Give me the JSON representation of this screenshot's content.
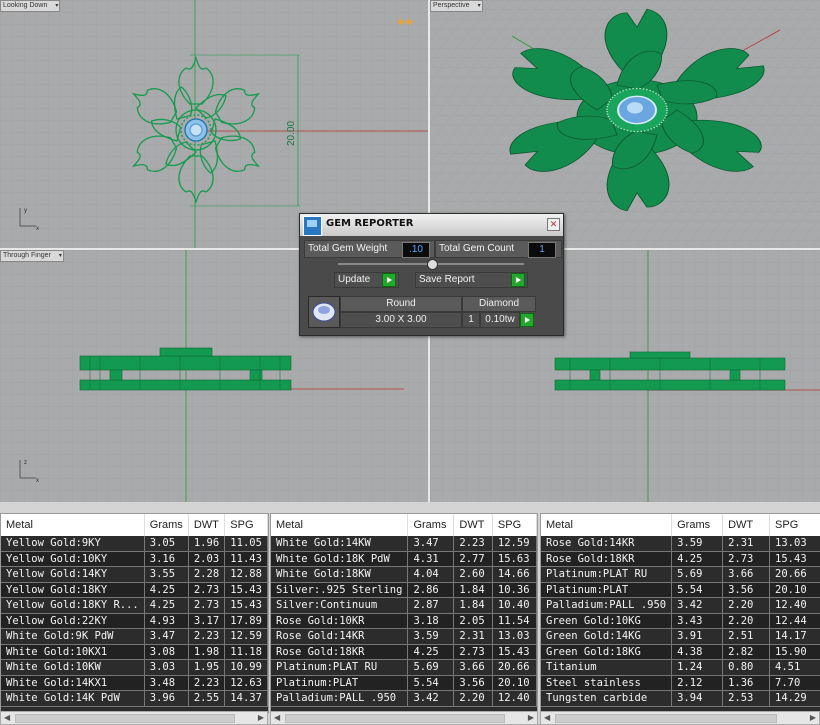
{
  "viewports": {
    "top_left": "Looking Down",
    "top_right": "Perspective",
    "bottom_left": "Through Finger",
    "dimension": "20.00"
  },
  "gem_reporter": {
    "title": "GEM REPORTER",
    "total_gem_weight_label": "Total Gem Weight",
    "total_gem_weight": ".10",
    "total_gem_count_label": "Total Gem Count",
    "total_gem_count": "1",
    "update_label": "Update",
    "save_report_label": "Save Report",
    "shape_header": "Round",
    "type_header": "Diamond",
    "size": "3.00 X 3.00",
    "count": "1",
    "weight": "0.10tw"
  },
  "metal_tables": {
    "columns": [
      "Metal",
      "Grams",
      "DWT",
      "SPG"
    ],
    "panel1": [
      [
        "Yellow Gold:9KY",
        "3.05",
        "1.96",
        "11.05"
      ],
      [
        "Yellow Gold:10KY",
        "3.16",
        "2.03",
        "11.43"
      ],
      [
        "Yellow Gold:14KY",
        "3.55",
        "2.28",
        "12.88"
      ],
      [
        "Yellow Gold:18KY",
        "4.25",
        "2.73",
        "15.43"
      ],
      [
        "Yellow Gold:18KY R...",
        "4.25",
        "2.73",
        "15.43"
      ],
      [
        "Yellow Gold:22KY",
        "4.93",
        "3.17",
        "17.89"
      ],
      [
        "White Gold:9K PdW",
        "3.47",
        "2.23",
        "12.59"
      ],
      [
        "White Gold:10KX1",
        "3.08",
        "1.98",
        "11.18"
      ],
      [
        "White Gold:10KW",
        "3.03",
        "1.95",
        "10.99"
      ],
      [
        "White Gold:14KX1",
        "3.48",
        "2.23",
        "12.63"
      ],
      [
        "White Gold:14K PdW",
        "3.96",
        "2.55",
        "14.37"
      ]
    ],
    "panel2": [
      [
        "White Gold:14KW",
        "3.47",
        "2.23",
        "12.59"
      ],
      [
        "White Gold:18K PdW",
        "4.31",
        "2.77",
        "15.63"
      ],
      [
        "White Gold:18KW",
        "4.04",
        "2.60",
        "14.66"
      ],
      [
        "Silver:.925 Sterling",
        "2.86",
        "1.84",
        "10.36"
      ],
      [
        "Silver:Continuum",
        "2.87",
        "1.84",
        "10.40"
      ],
      [
        "Rose Gold:10KR",
        "3.18",
        "2.05",
        "11.54"
      ],
      [
        "Rose Gold:14KR",
        "3.59",
        "2.31",
        "13.03"
      ],
      [
        "Rose Gold:18KR",
        "4.25",
        "2.73",
        "15.43"
      ],
      [
        "Platinum:PLAT RU",
        "5.69",
        "3.66",
        "20.66"
      ],
      [
        "Platinum:PLAT",
        "5.54",
        "3.56",
        "20.10"
      ],
      [
        "Palladium:PALL .950",
        "3.42",
        "2.20",
        "12.40"
      ]
    ],
    "panel3": [
      [
        "Rose Gold:14KR",
        "3.59",
        "2.31",
        "13.03"
      ],
      [
        "Rose Gold:18KR",
        "4.25",
        "2.73",
        "15.43"
      ],
      [
        "Platinum:PLAT RU",
        "5.69",
        "3.66",
        "20.66"
      ],
      [
        "Platinum:PLAT",
        "5.54",
        "3.56",
        "20.10"
      ],
      [
        "Palladium:PALL .950",
        "3.42",
        "2.20",
        "12.40"
      ],
      [
        "Green Gold:10KG",
        "3.43",
        "2.20",
        "12.44"
      ],
      [
        "Green Gold:14KG",
        "3.91",
        "2.51",
        "14.17"
      ],
      [
        "Green Gold:18KG",
        "4.38",
        "2.82",
        "15.90"
      ],
      [
        "Titanium",
        "1.24",
        "0.80",
        "4.51"
      ],
      [
        "Steel stainless",
        "2.12",
        "1.36",
        "7.70"
      ],
      [
        "Tungsten carbide",
        "3.94",
        "2.53",
        "14.29"
      ]
    ]
  }
}
